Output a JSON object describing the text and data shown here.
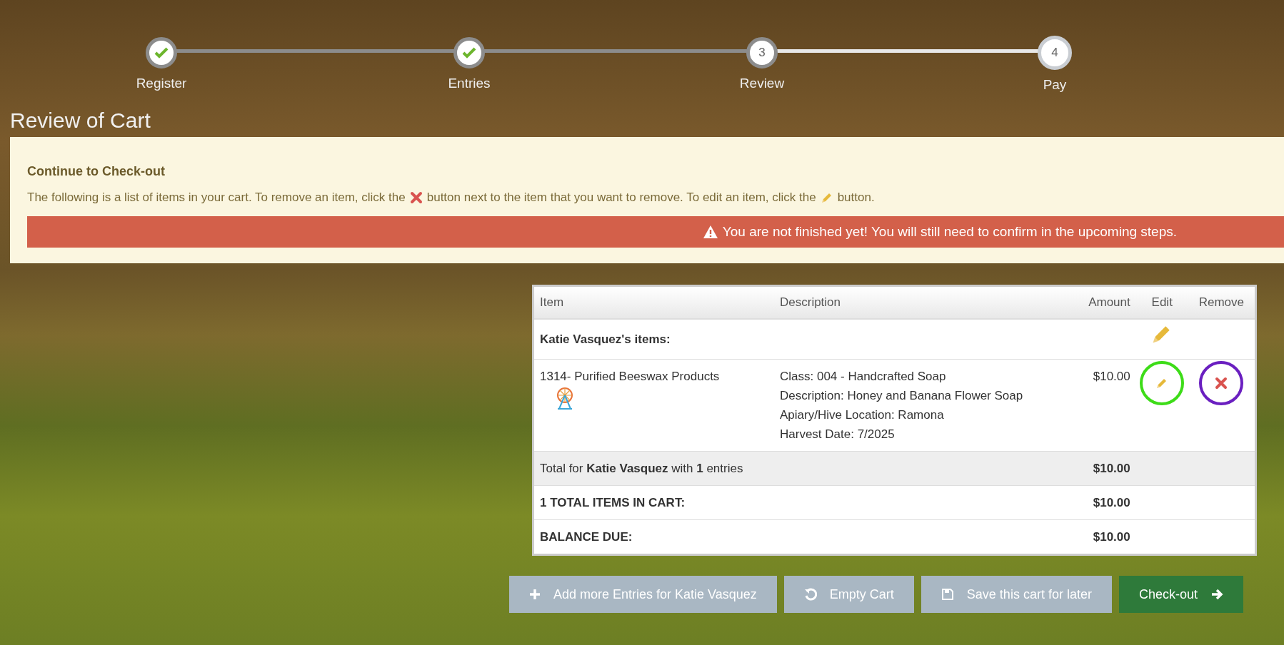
{
  "steps": [
    {
      "label": "Register",
      "completed": true,
      "current": false
    },
    {
      "label": "Entries",
      "completed": true,
      "current": false
    },
    {
      "label": "Review",
      "number": "3",
      "completed": false,
      "current": false
    },
    {
      "label": "Pay",
      "number": "4",
      "completed": false,
      "current": true
    }
  ],
  "page_title": "Review of Cart",
  "notice": {
    "heading": "Continue to Check-out",
    "text_parts": [
      "The following is a list of items in your cart. To remove an item, click the",
      "button next to the item that you want to remove. To edit an item, click the",
      "button."
    ],
    "warning": "You are not finished yet! You will still need to confirm in the upcoming steps."
  },
  "table": {
    "columns": [
      "Item",
      "Description",
      "Amount",
      "Edit",
      "Remove"
    ],
    "groups": [
      {
        "heading": "Katie Vasquez's items:",
        "editable": true,
        "rows": [
          {
            "item": "1314- Purified Beeswax Products",
            "description": [
              "Class: 004 - Handcrafted Soap",
              "Description: Honey and Banana Flower Soap",
              "Apiary/Hive Location: Ramona",
              "Harvest Date: 7/2025"
            ],
            "amount": "$10.00",
            "edit_circled": true,
            "remove_circled": true
          }
        ]
      }
    ],
    "summary": [
      {
        "label": "Total for **Katie Vasquez** with **1** entries",
        "amount": "$10.00",
        "shaded": true
      },
      {
        "label": "1 TOTAL ITEMS IN CART:",
        "amount": "$10.00",
        "shaded": false
      },
      {
        "label": "BALANCE DUE:",
        "amount": "$10.00",
        "shaded": false
      }
    ]
  },
  "buttons": [
    {
      "label": "Add more Entries for Katie Vasquez",
      "kind": "add"
    },
    {
      "label": "Empty Cart",
      "kind": "reset"
    },
    {
      "label": "Save this cart for later",
      "kind": "save"
    },
    {
      "label": "Check-out",
      "kind": "proceed"
    }
  ]
}
